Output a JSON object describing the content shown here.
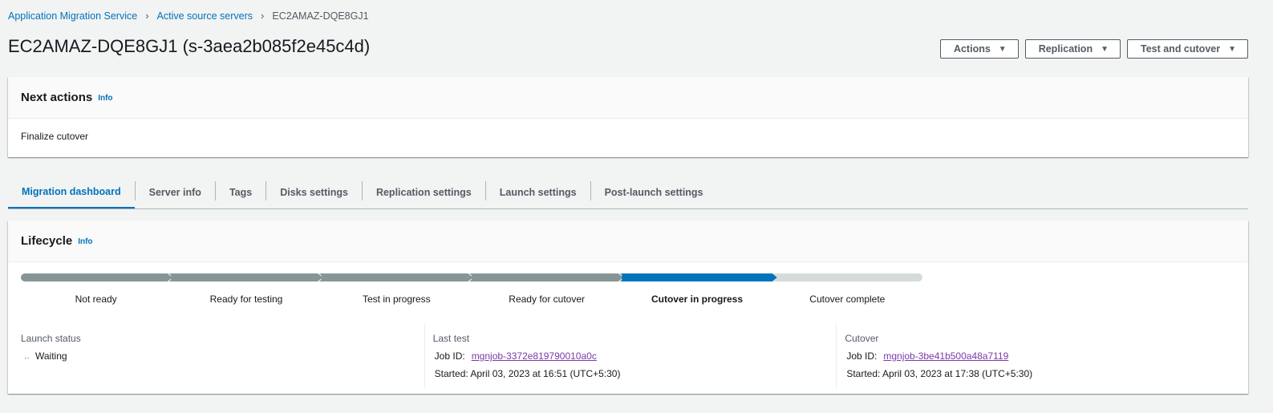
{
  "breadcrumb": {
    "items": [
      "Application Migration Service",
      "Active source servers"
    ],
    "current": "EC2AMAZ-DQE8GJ1"
  },
  "header": {
    "title": "EC2AMAZ-DQE8GJ1 (s-3aea2b085f2e45c4d)",
    "actions_label": "Actions",
    "replication_label": "Replication",
    "test_cutover_label": "Test and cutover"
  },
  "next_actions": {
    "title": "Next actions",
    "info": "Info",
    "body": "Finalize cutover"
  },
  "tabs": [
    {
      "label": "Migration dashboard",
      "active": true
    },
    {
      "label": "Server info"
    },
    {
      "label": "Tags"
    },
    {
      "label": "Disks settings"
    },
    {
      "label": "Replication settings"
    },
    {
      "label": "Launch settings"
    },
    {
      "label": "Post-launch settings"
    }
  ],
  "lifecycle": {
    "title": "Lifecycle",
    "info": "Info",
    "steps": [
      "Not ready",
      "Ready for testing",
      "Test in progress",
      "Ready for cutover",
      "Cutover in progress",
      "Cutover complete"
    ],
    "current_step_index": 4
  },
  "launch_status": {
    "heading": "Launch status",
    "value": "Waiting"
  },
  "last_test": {
    "heading": "Last test",
    "job_label": "Job ID:",
    "job_id": "mgnjob-3372e819790010a0c",
    "started": "Started: April 03, 2023 at 16:51 (UTC+5:30)"
  },
  "cutover": {
    "heading": "Cutover",
    "job_label": "Job ID:",
    "job_id": "mgnjob-3be41b500a48a7119",
    "started": "Started: April 03, 2023 at 17:38 (UTC+5:30)"
  },
  "colors": {
    "accent": "#0073bb",
    "completed_step": "#879596",
    "upcoming_step": "#d5dbdb",
    "visited_link": "#7c3aa6"
  }
}
